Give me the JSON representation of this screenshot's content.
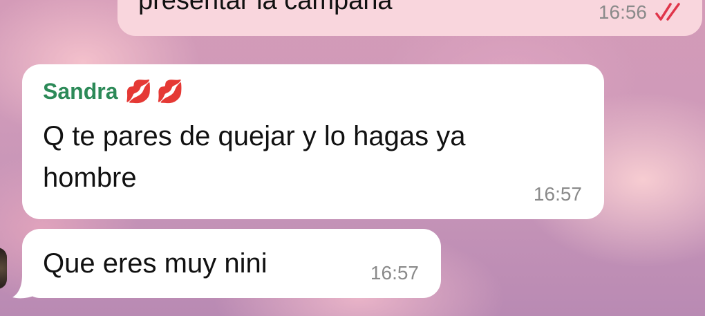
{
  "colors": {
    "sender_name": "#2c8a58",
    "outgoing_bubble": "#f9d6dd",
    "incoming_bubble": "#ffffff",
    "timestamp": "#8a8a8a",
    "read_check": "#e0354a"
  },
  "outgoing_message": {
    "text": "presentar la campaña",
    "time": "16:56",
    "status_icon": "double-check-icon"
  },
  "messages": [
    {
      "sender": "Sandra",
      "sender_emoji": "💋💋",
      "lines": [
        "Q te pares de quejar y lo hagas ya",
        "hombre"
      ],
      "time": "16:57"
    },
    {
      "text": "Que eres muy nini",
      "time": "16:57"
    }
  ]
}
